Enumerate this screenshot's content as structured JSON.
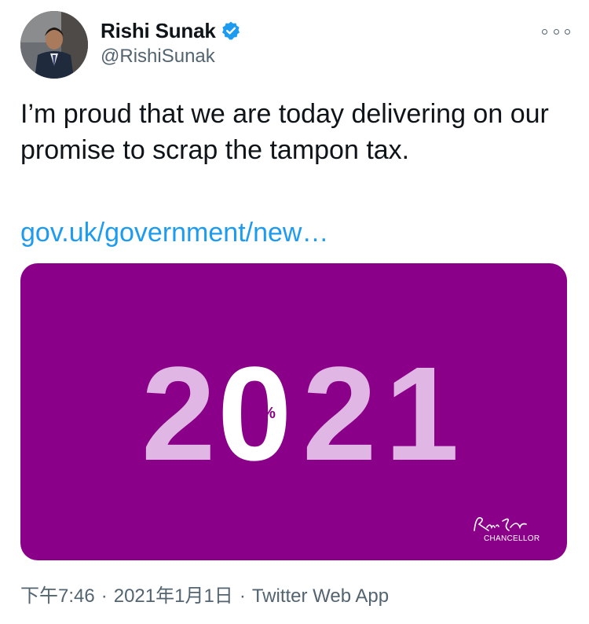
{
  "author": {
    "display_name": "Rishi Sunak",
    "handle": "@RishiSunak",
    "verified": true
  },
  "tweet": {
    "text": "I’m proud that we are today delivering on our promise to scrap the tampon tax.",
    "link_text": "gov.uk/government/new…"
  },
  "media": {
    "background_color": "#8b0088",
    "number_color": "#e0b6e4",
    "highlight_color": "#ffffff",
    "year_digits": [
      "2",
      "0",
      "2",
      "1"
    ],
    "percent_symbol": "%",
    "signature_caption": "CHANCELLOR"
  },
  "meta": {
    "time": "下午7:46",
    "date": "2021年1月1日",
    "source": "Twitter Web App",
    "separator": "·"
  },
  "icons": {
    "verified": "verified-badge-icon",
    "more": "more-options-icon"
  },
  "colors": {
    "link": "#1d9bf0",
    "secondary_text": "#536471",
    "primary_text": "#0f1419"
  }
}
